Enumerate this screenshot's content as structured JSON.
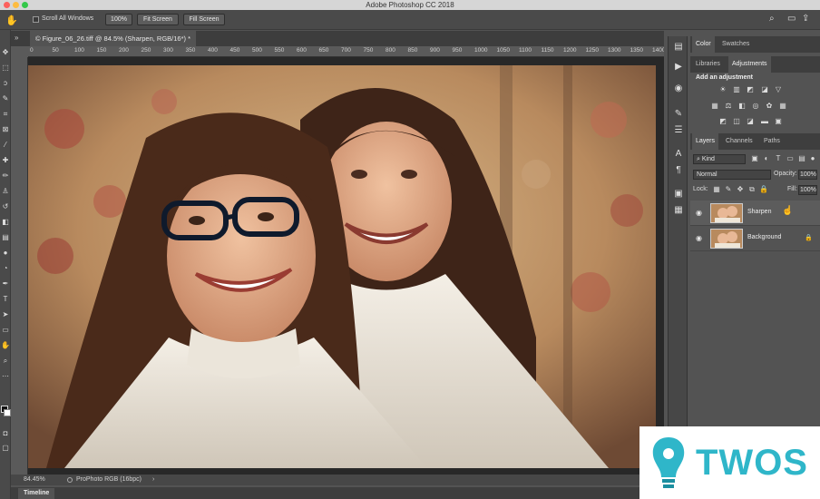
{
  "app": {
    "title": "Adobe Photoshop CC 2018"
  },
  "options": {
    "scroll_all_label": "Scroll All Windows",
    "zoom_btn": "100%",
    "fit_screen": "Fit Screen",
    "fill_screen": "Fill Screen"
  },
  "document": {
    "tab_label": "© Figure_06_26.tiff @ 84.5% (Sharpen, RGB/16*) *",
    "ruler_ticks": [
      "0",
      "50",
      "100",
      "150",
      "200",
      "250",
      "300",
      "350",
      "400",
      "450",
      "500",
      "550",
      "600",
      "650",
      "700",
      "750",
      "800",
      "850",
      "900",
      "950",
      "1000",
      "1050",
      "1100",
      "1150",
      "1200",
      "1250",
      "1300",
      "1350",
      "1400"
    ],
    "zoom": "84.45%",
    "profile": "ProPhoto RGB (16bpc)"
  },
  "timeline": {
    "label": "Timeline"
  },
  "panels": {
    "color_tab": "Color",
    "swatches_tab": "Swatches",
    "libraries_tab": "Libraries",
    "adjustments_tab": "Adjustments",
    "add_adjustment": "Add an adjustment",
    "layers_tab": "Layers",
    "channels_tab": "Channels",
    "paths_tab": "Paths",
    "kind_filter": "Kind",
    "blend_mode": "Normal",
    "opacity_label": "Opacity:",
    "opacity_value": "100%",
    "lock_label": "Lock:",
    "fill_label": "Fill:",
    "fill_value": "100%",
    "layers": [
      {
        "name": "Sharpen"
      },
      {
        "name": "Background"
      }
    ]
  },
  "watermark": {
    "text": "TWOS"
  },
  "colors": {
    "accent": "#2fb6c9",
    "ui_dark": "#535353"
  }
}
